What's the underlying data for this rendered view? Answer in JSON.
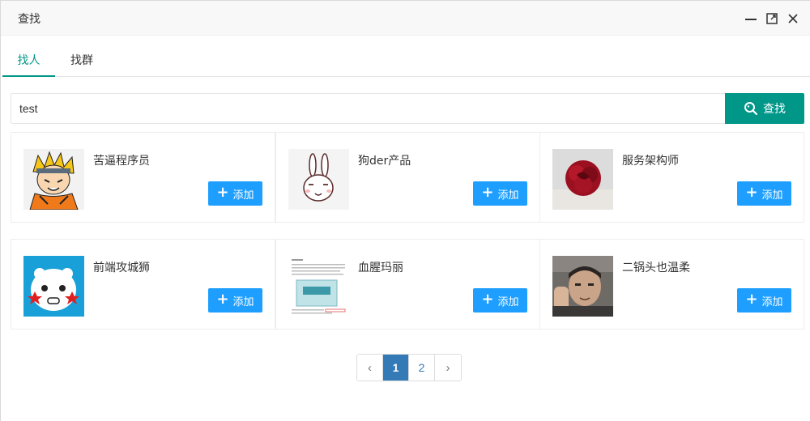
{
  "window": {
    "title": "查找"
  },
  "tabs": [
    {
      "label": "找人",
      "active": true
    },
    {
      "label": "找群",
      "active": false
    }
  ],
  "search": {
    "value": "test",
    "button_label": "查找"
  },
  "results": [
    {
      "name": "苦逼程序员",
      "add_label": "添加",
      "avatar_icon": "anime-ninja-avatar"
    },
    {
      "name": "狗der产品",
      "add_label": "添加",
      "avatar_icon": "rabbit-avatar"
    },
    {
      "name": "服务架构师",
      "add_label": "添加",
      "avatar_icon": "red-rose-avatar"
    },
    {
      "name": "前端攻城狮",
      "add_label": "添加",
      "avatar_icon": "white-cartoon-face-avatar"
    },
    {
      "name": "血腥玛丽",
      "add_label": "添加",
      "avatar_icon": "document-screenshot-avatar"
    },
    {
      "name": "二锅头也温柔",
      "add_label": "添加",
      "avatar_icon": "man-photo-avatar"
    }
  ],
  "pagination": {
    "prev": "‹",
    "pages": [
      "1",
      "2"
    ],
    "current": "1",
    "next": "›"
  },
  "colors": {
    "primary": "#009688",
    "add_button": "#1e9fff",
    "pager_active": "#337ab7"
  }
}
